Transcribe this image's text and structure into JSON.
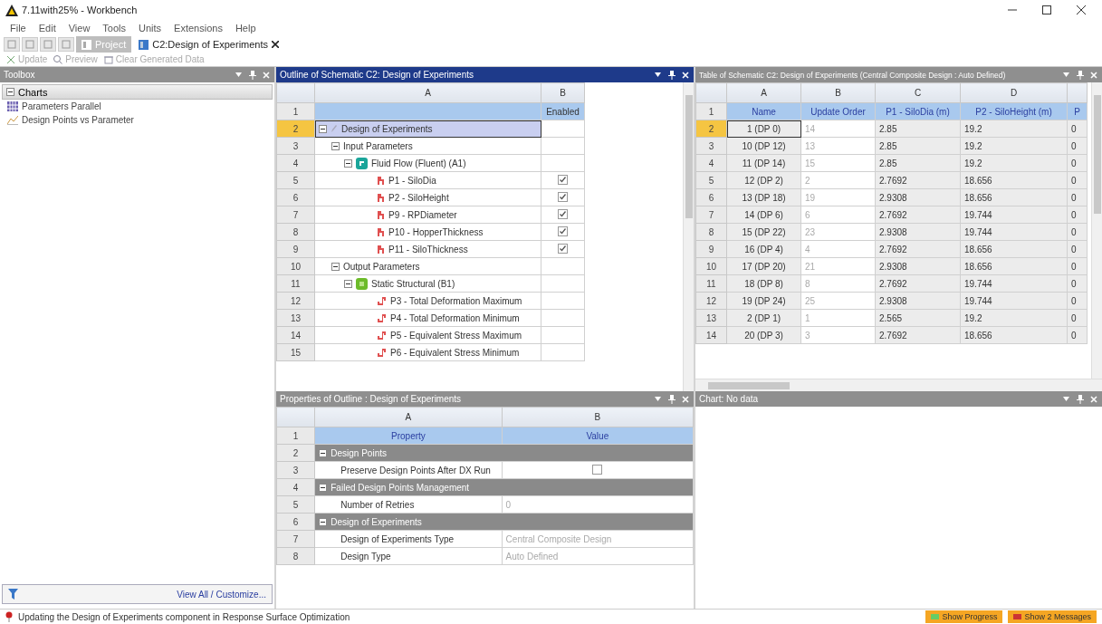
{
  "window": {
    "title": "7.11with25% - Workbench"
  },
  "menu": [
    "File",
    "Edit",
    "View",
    "Tools",
    "Units",
    "Extensions",
    "Help"
  ],
  "tabs": [
    {
      "label": "Project",
      "selected": false,
      "closable": false
    },
    {
      "label": "C2:Design of Experiments",
      "selected": true,
      "closable": true
    }
  ],
  "toolbar": [
    {
      "label": "Update",
      "disabled": true
    },
    {
      "label": "Preview",
      "disabled": true
    },
    {
      "label": "Clear Generated Data",
      "disabled": true
    }
  ],
  "toolbox": {
    "title": "Toolbox",
    "group": {
      "label": "Charts",
      "expanded": true
    },
    "items": [
      {
        "label": "Parameters Parallel",
        "kind": "parallel"
      },
      {
        "label": "Design Points vs Parameter",
        "kind": "line"
      }
    ],
    "footer": "View All / Customize..."
  },
  "outline": {
    "title": "Outline of Schematic C2: Design of Experiments",
    "active": true,
    "columns": [
      "A",
      "B"
    ],
    "header_row": {
      "num": "1",
      "b": "Enabled"
    },
    "tree": [
      {
        "num": "2",
        "label": "Design of Experiments",
        "kind": "root",
        "selected": true,
        "expanded": true,
        "children": [
          {
            "num": "3",
            "label": "Input Parameters",
            "selected": false,
            "expanded": true,
            "children": [
              {
                "num": "4",
                "label": "Fluid Flow (Fluent) (A1)",
                "kind": "fluent",
                "selected": false,
                "expanded": true,
                "children": [
                  {
                    "num": "5",
                    "label": "P1 - SiloDia",
                    "kind": "input",
                    "selected": false,
                    "checked": true
                  },
                  {
                    "num": "6",
                    "label": "P2 - SiloHeight",
                    "kind": "input",
                    "selected": false,
                    "checked": true
                  },
                  {
                    "num": "7",
                    "label": "P9 - RPDiameter",
                    "kind": "input",
                    "selected": false,
                    "checked": true
                  },
                  {
                    "num": "8",
                    "label": "P10 - HopperThickness",
                    "kind": "input",
                    "selected": false,
                    "checked": true
                  },
                  {
                    "num": "9",
                    "label": "P11 - SiloThickness",
                    "kind": "input",
                    "selected": false,
                    "checked": true
                  }
                ]
              }
            ]
          },
          {
            "num": "10",
            "label": "Output Parameters",
            "selected": false,
            "expanded": true,
            "children": [
              {
                "num": "11",
                "label": "Static Structural (B1)",
                "kind": "structural",
                "selected": false,
                "expanded": true,
                "children": [
                  {
                    "num": "12",
                    "label": "P3 - Total Deformation Maximum",
                    "kind": "output",
                    "selected": false
                  },
                  {
                    "num": "13",
                    "label": "P4 - Total Deformation Minimum",
                    "kind": "output",
                    "selected": false
                  },
                  {
                    "num": "14",
                    "label": "P5 - Equivalent Stress Maximum",
                    "kind": "output",
                    "selected": false
                  },
                  {
                    "num": "15",
                    "label": "P6 - Equivalent Stress Minimum",
                    "kind": "output",
                    "selected": false
                  }
                ]
              }
            ]
          }
        ]
      }
    ]
  },
  "properties": {
    "title": "Properties of Outline : Design of Experiments",
    "columns": [
      "A",
      "B"
    ],
    "rows": [
      {
        "num": "1",
        "kind": "header",
        "a": "Property",
        "b": "Value"
      },
      {
        "num": "2",
        "kind": "section",
        "a": "Design Points",
        "expanded": true
      },
      {
        "num": "3",
        "kind": "check",
        "a": "Preserve Design Points After DX Run",
        "checked": false
      },
      {
        "num": "4",
        "kind": "section",
        "a": "Failed Design Points Management",
        "expanded": true
      },
      {
        "num": "5",
        "kind": "text",
        "a": "Number of Retries",
        "b": "0"
      },
      {
        "num": "6",
        "kind": "section",
        "a": "Design of Experiments",
        "expanded": true
      },
      {
        "num": "7",
        "kind": "text",
        "a": "Design of Experiments Type",
        "b": "Central Composite Design"
      },
      {
        "num": "8",
        "kind": "text",
        "a": "Design Type",
        "b": "Auto Defined"
      }
    ]
  },
  "table": {
    "title": "Table of Schematic C2: Design of Experiments (Central Composite Design : Auto Defined)",
    "columns": [
      "A",
      "B",
      "C",
      "D"
    ],
    "header_row": {
      "num": "1",
      "cells": [
        "Name",
        "Update Order",
        "P1 - SiloDia (m)",
        "P2 - SiloHeight (m)",
        "P"
      ]
    },
    "rows": [
      {
        "num": "2",
        "selected": true,
        "cells": [
          "1 (DP 0)",
          "14",
          "2.85",
          "19.2",
          "0"
        ]
      },
      {
        "num": "3",
        "selected": false,
        "cells": [
          "10 (DP 12)",
          "13",
          "2.85",
          "19.2",
          "0"
        ]
      },
      {
        "num": "4",
        "selected": false,
        "cells": [
          "11 (DP 14)",
          "15",
          "2.85",
          "19.2",
          "0"
        ]
      },
      {
        "num": "5",
        "selected": false,
        "cells": [
          "12 (DP 2)",
          "2",
          "2.7692",
          "18.656",
          "0"
        ]
      },
      {
        "num": "6",
        "selected": false,
        "cells": [
          "13 (DP 18)",
          "19",
          "2.9308",
          "18.656",
          "0"
        ]
      },
      {
        "num": "7",
        "selected": false,
        "cells": [
          "14 (DP 6)",
          "6",
          "2.7692",
          "19.744",
          "0"
        ]
      },
      {
        "num": "8",
        "selected": false,
        "cells": [
          "15 (DP 22)",
          "23",
          "2.9308",
          "19.744",
          "0"
        ]
      },
      {
        "num": "9",
        "selected": false,
        "cells": [
          "16 (DP 4)",
          "4",
          "2.7692",
          "18.656",
          "0"
        ]
      },
      {
        "num": "10",
        "selected": false,
        "cells": [
          "17 (DP 20)",
          "21",
          "2.9308",
          "18.656",
          "0"
        ]
      },
      {
        "num": "11",
        "selected": false,
        "cells": [
          "18 (DP 8)",
          "8",
          "2.7692",
          "19.744",
          "0"
        ]
      },
      {
        "num": "12",
        "selected": false,
        "cells": [
          "19 (DP 24)",
          "25",
          "2.9308",
          "19.744",
          "0"
        ]
      },
      {
        "num": "13",
        "selected": false,
        "cells": [
          "2 (DP 1)",
          "1",
          "2.565",
          "19.2",
          "0"
        ]
      },
      {
        "num": "14",
        "selected": false,
        "cells": [
          "20 (DP 3)",
          "3",
          "2.7692",
          "18.656",
          "0"
        ]
      }
    ]
  },
  "chart": {
    "title": "Chart: No data"
  },
  "status": {
    "message": "Updating the Design of Experiments component in Response Surface Optimization",
    "buttons": [
      "Show Progress",
      "Show 2 Messages"
    ]
  }
}
